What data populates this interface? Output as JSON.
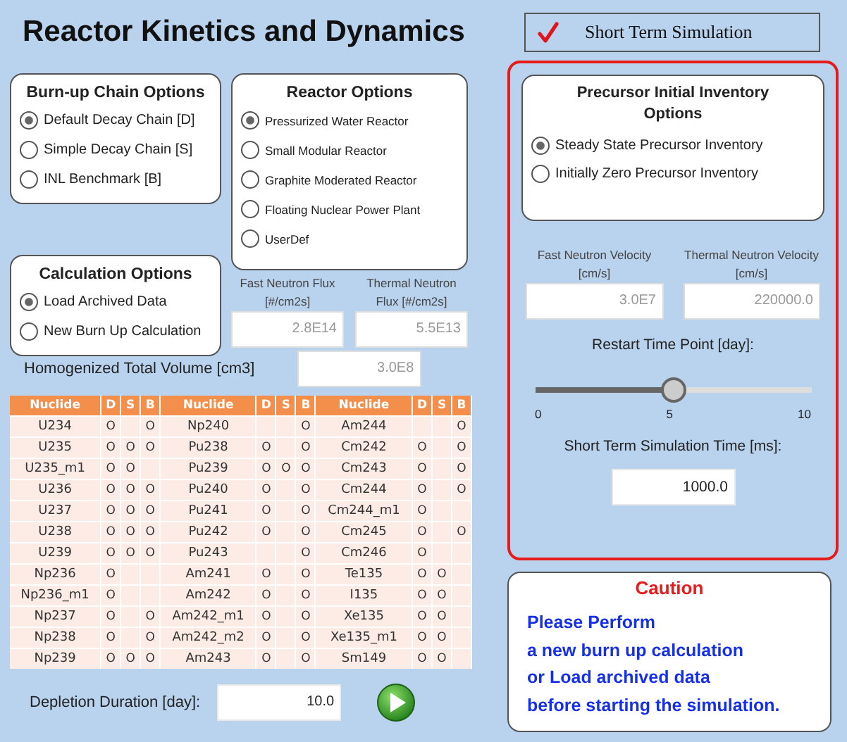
{
  "title": "Reactor Kinetics and Dynamics",
  "short_term_toggle": {
    "label": "Short Term Simulation",
    "checked": true
  },
  "burnup_chain": {
    "title": "Burn-up Chain Options",
    "options": [
      {
        "label": "Default Decay Chain [D]",
        "selected": true
      },
      {
        "label": "Simple Decay Chain [S]",
        "selected": false
      },
      {
        "label": "INL Benchmark [B]",
        "selected": false
      }
    ]
  },
  "reactor": {
    "title": "Reactor Options",
    "options": [
      {
        "label": "Pressurized Water Reactor",
        "selected": true
      },
      {
        "label": "Small Modular Reactor",
        "selected": false
      },
      {
        "label": "Graphite Moderated Reactor",
        "selected": false
      },
      {
        "label": "Floating Nuclear Power Plant",
        "selected": false
      },
      {
        "label": "UserDef",
        "selected": false
      }
    ]
  },
  "calculation": {
    "title": "Calculation Options",
    "options": [
      {
        "label": "Load Archived Data",
        "selected": true
      },
      {
        "label": "New Burn Up Calculation",
        "selected": false
      }
    ]
  },
  "flux": [
    {
      "label": "Fast Neutron Flux [#/cm2s]",
      "value": "2.8E14"
    },
    {
      "label": "Thermal Neutron Flux [#/cm2s]",
      "value": "5.5E13"
    }
  ],
  "volume": {
    "label": "Homogenized Total Volume [cm3]",
    "value": "3.0E8"
  },
  "table": {
    "columns": [
      "Nuclide",
      "D",
      "S",
      "B",
      "Nuclide",
      "D",
      "S",
      "B",
      "Nuclide",
      "D",
      "S",
      "B"
    ],
    "rows": [
      [
        {
          "nuclide": "U234",
          "D": "O",
          "B": "O"
        },
        {
          "nuclide": "Np240",
          "B": "O"
        },
        {
          "nuclide": "Am244",
          "B": "O"
        }
      ],
      [
        {
          "nuclide": "U235",
          "D": "O",
          "S": "O",
          "B": "O"
        },
        {
          "nuclide": "Pu238",
          "D": "O",
          "B": "O"
        },
        {
          "nuclide": "Cm242",
          "D": "O",
          "B": "O"
        }
      ],
      [
        {
          "nuclide": "U235_m1",
          "D": "O",
          "S": "O"
        },
        {
          "nuclide": "Pu239",
          "D": "O",
          "S": "O",
          "B": "O"
        },
        {
          "nuclide": "Cm243",
          "D": "O",
          "B": "O"
        }
      ],
      [
        {
          "nuclide": "U236",
          "D": "O",
          "S": "O",
          "B": "O"
        },
        {
          "nuclide": "Pu240",
          "D": "O",
          "B": "O"
        },
        {
          "nuclide": "Cm244",
          "D": "O",
          "B": "O"
        }
      ],
      [
        {
          "nuclide": "U237",
          "D": "O",
          "S": "O",
          "B": "O"
        },
        {
          "nuclide": "Pu241",
          "D": "O",
          "B": "O"
        },
        {
          "nuclide": "Cm244_m1",
          "D": "O"
        }
      ],
      [
        {
          "nuclide": "U238",
          "D": "O",
          "S": "O",
          "B": "O"
        },
        {
          "nuclide": "Pu242",
          "D": "O",
          "B": "O"
        },
        {
          "nuclide": "Cm245",
          "D": "O",
          "B": "O"
        }
      ],
      [
        {
          "nuclide": "U239",
          "D": "O",
          "S": "O",
          "B": "O"
        },
        {
          "nuclide": "Pu243",
          "B": "O"
        },
        {
          "nuclide": "Cm246",
          "D": "O"
        }
      ],
      [
        {
          "nuclide": "Np236",
          "D": "O"
        },
        {
          "nuclide": "Am241",
          "D": "O",
          "B": "O"
        },
        {
          "nuclide": "Te135",
          "D": "O",
          "S": "O"
        }
      ],
      [
        {
          "nuclide": "Np236_m1",
          "D": "O"
        },
        {
          "nuclide": "Am242",
          "D": "O",
          "B": "O"
        },
        {
          "nuclide": "I135",
          "D": "O",
          "S": "O"
        }
      ],
      [
        {
          "nuclide": "Np237",
          "D": "O",
          "B": "O"
        },
        {
          "nuclide": "Am242_m1",
          "D": "O",
          "B": "O"
        },
        {
          "nuclide": "Xe135",
          "D": "O",
          "S": "O"
        }
      ],
      [
        {
          "nuclide": "Np238",
          "D": "O",
          "B": "O"
        },
        {
          "nuclide": "Am242_m2",
          "D": "O",
          "B": "O"
        },
        {
          "nuclide": "Xe135_m1",
          "D": "O",
          "S": "O"
        }
      ],
      [
        {
          "nuclide": "Np239",
          "D": "O",
          "S": "O",
          "B": "O"
        },
        {
          "nuclide": "Am243",
          "D": "O",
          "B": "O"
        },
        {
          "nuclide": "Sm149",
          "D": "O",
          "S": "O"
        }
      ]
    ]
  },
  "depletion": {
    "label": "Depletion Duration [day]:",
    "value": "10.0"
  },
  "precursor": {
    "title": "Precursor Initial Inventory Options",
    "options": [
      {
        "label": "Steady State Precursor Inventory",
        "selected": true
      },
      {
        "label": "Initially Zero Precursor Inventory",
        "selected": false
      }
    ]
  },
  "velocity": [
    {
      "label": "Fast Neutron Velocity [cm/s]",
      "value": "3.0E7"
    },
    {
      "label": "Thermal Neutron Velocity [cm/s]",
      "value": "220000.0"
    }
  ],
  "restart": {
    "label": "Restart Time Point [day]:",
    "level": 0.5,
    "tick_labels": [
      "0",
      "5",
      "10"
    ]
  },
  "sim_time": {
    "label": "Short Term Simulation Time [ms]:",
    "value": "1000.0"
  },
  "caution": {
    "title": "Caution",
    "lines": [
      "Please Perform",
      "a new burn up calculation",
      "or Load  archived data",
      "before starting the simulation."
    ]
  }
}
